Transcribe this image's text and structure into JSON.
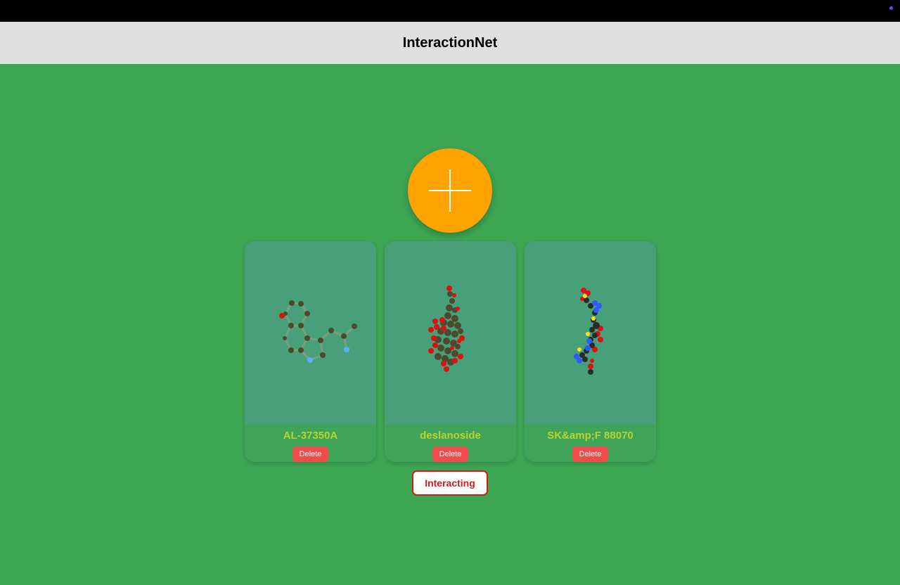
{
  "header": {
    "title": "InteractionNet"
  },
  "add_button": {
    "icon": "plus-icon",
    "color": "#ffa300"
  },
  "molecules": [
    {
      "name": "AL-37350A",
      "delete_label": "Delete"
    },
    {
      "name": "deslanoside",
      "delete_label": "Delete"
    },
    {
      "name": "SK&amp;F 88070",
      "delete_label": "Delete"
    }
  ],
  "actions": {
    "interacting_label": "Interacting"
  },
  "colors": {
    "background": "#3da653",
    "header": "#dfdfdf",
    "card_viewer": "#48a07a",
    "molecule_name": "#b7d432",
    "delete": "#ef4b4b",
    "interacting_text": "#d61a1a"
  }
}
